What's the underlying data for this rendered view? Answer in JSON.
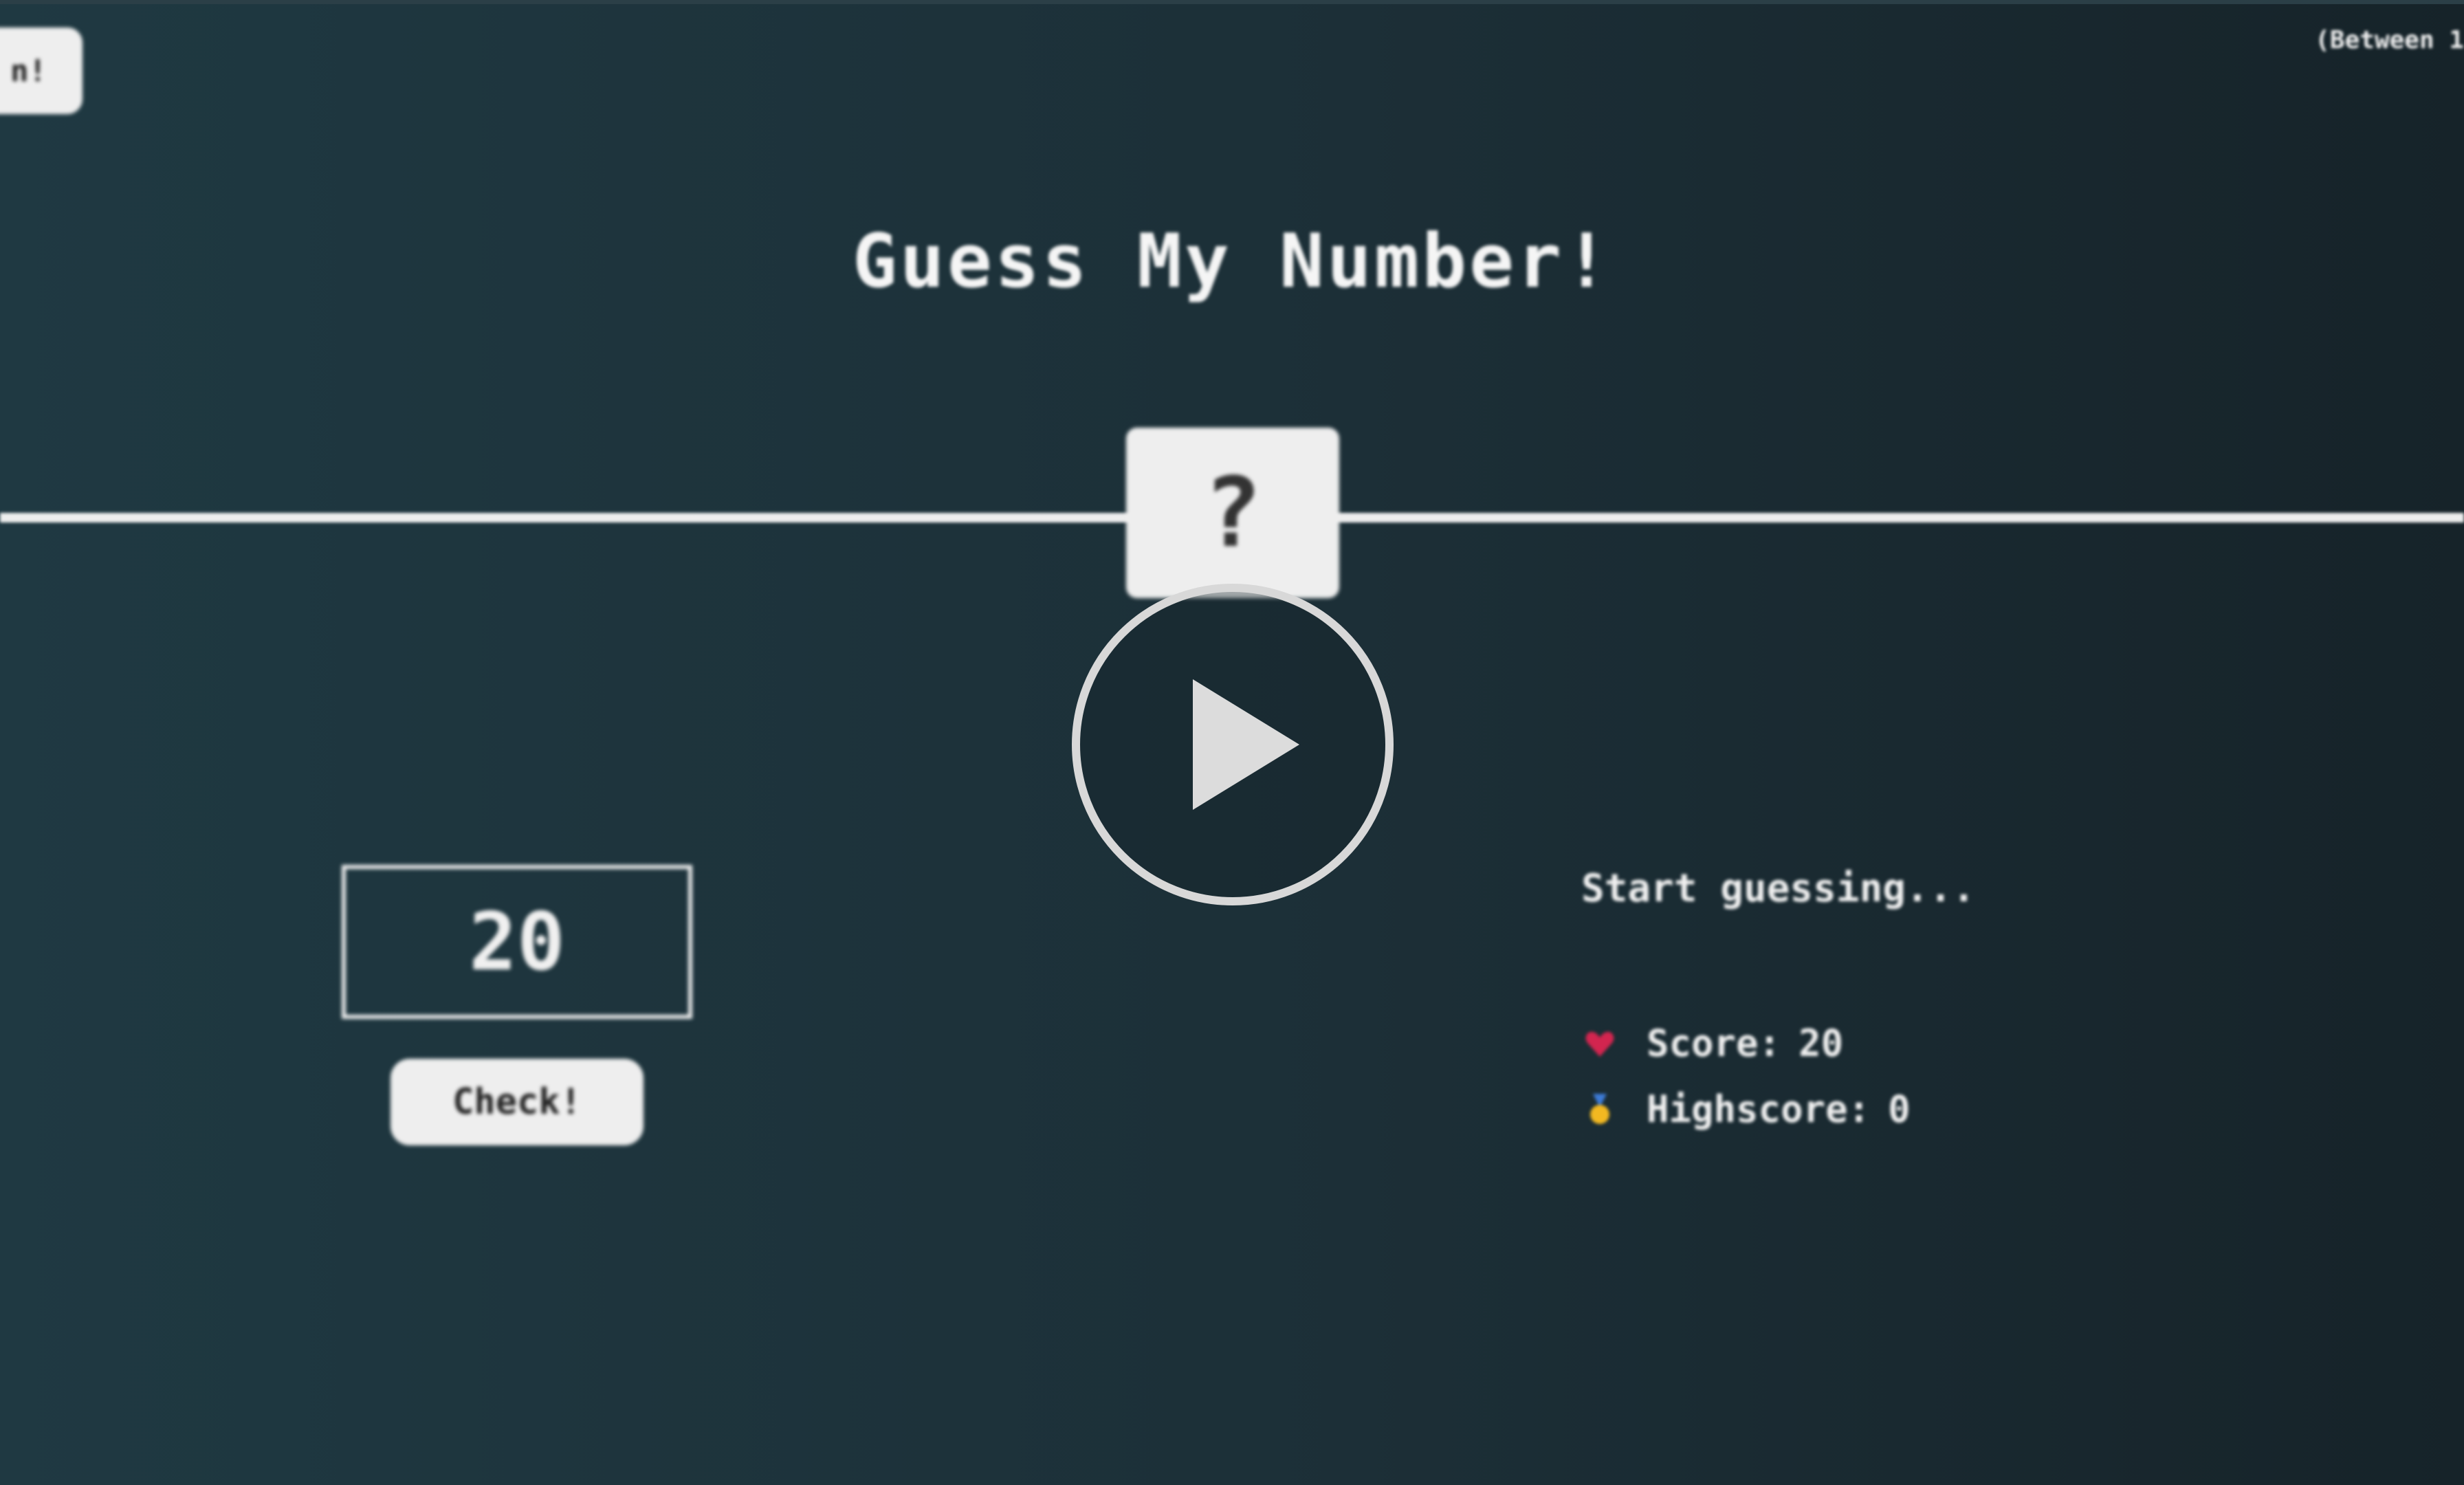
{
  "header": {
    "again_label": "n!",
    "between_text": "(Between 1"
  },
  "game": {
    "title": "Guess My Number!",
    "secret_placeholder": "?",
    "guess_value": "20",
    "check_label": "Check!",
    "message": "Start guessing...",
    "score_label": "Score:",
    "score_value": "20",
    "highscore_label": "Highscore:",
    "highscore_value": "0"
  },
  "icons": {
    "score": "heart-icon",
    "highscore": "medal-icon",
    "overlay": "play-icon"
  },
  "colors": {
    "background_left": "#1f3942",
    "background_right": "#162329",
    "text": "#f0f0f0",
    "panel": "#eeeeee",
    "heart": "#d2254f",
    "medal": "#f2b821",
    "medal_ribbon": "#3d7bd6"
  }
}
